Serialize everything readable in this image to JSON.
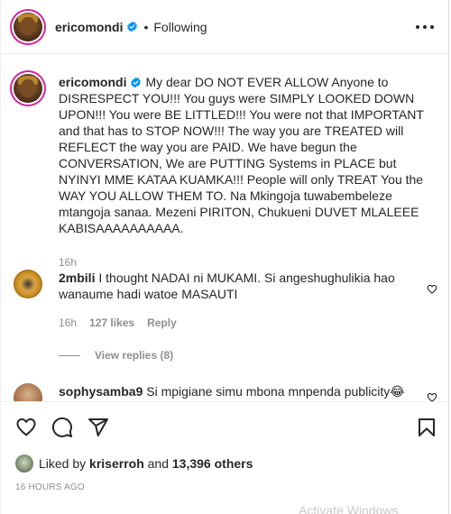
{
  "header": {
    "username": "ericomondi",
    "separator": "•",
    "follow_status": "Following"
  },
  "caption": {
    "username": "ericomondi",
    "text": "My dear DO NOT EVER ALLOW Anyone to DISRESPECT YOU!!! You guys were SIMPLY LOOKED DOWN UPON!!! You were BE LITTLED!!! You were not that IMPORTANT and that has to STOP NOW!!! The way you are TREATED will REFLECT the way you are PAID. We have begun the CONVERSATION, We are PUTTING Systems in PLACE but NYINYI MME KATAA KUAMKA!!! People will only TREAT You the WAY YOU ALLOW THEM TO. Na Mkingoja tuwabembeleze mtangoja sanaa. Mezeni PIRITON, Chukueni DUVET MLALEEE KABISAAAAAAAAAA.",
    "time": "16h"
  },
  "comments": [
    {
      "username": "2mbili",
      "text": "I thought NADAI ni MUKAMI. Si angeshughulikia hao wanaume hadi watoe MASAUTI",
      "time": "16h",
      "likes": "127 likes",
      "reply_label": "Reply",
      "view_replies": "View replies (8)"
    },
    {
      "username": "sophysamba9",
      "text": "Si mpigiane simu mbona mnpenda publicity😂"
    }
  ],
  "actions": {
    "liked_by_prefix": "Liked by",
    "liked_by_user": "kriserroh",
    "liked_by_conjunction": "and",
    "liked_by_others": "13,396 others",
    "timestamp": "16 HOURS AGO"
  },
  "icons": {
    "verified": "verified-badge-icon",
    "more": "more-options-icon",
    "like": "heart-icon",
    "comment": "comment-icon",
    "share": "send-icon",
    "save": "bookmark-icon"
  },
  "colors": {
    "verified": "#0095f6",
    "muted": "#8e8e8e",
    "text": "#262626",
    "story_ring": "#d6249f"
  },
  "watermark": "Activate Windows"
}
